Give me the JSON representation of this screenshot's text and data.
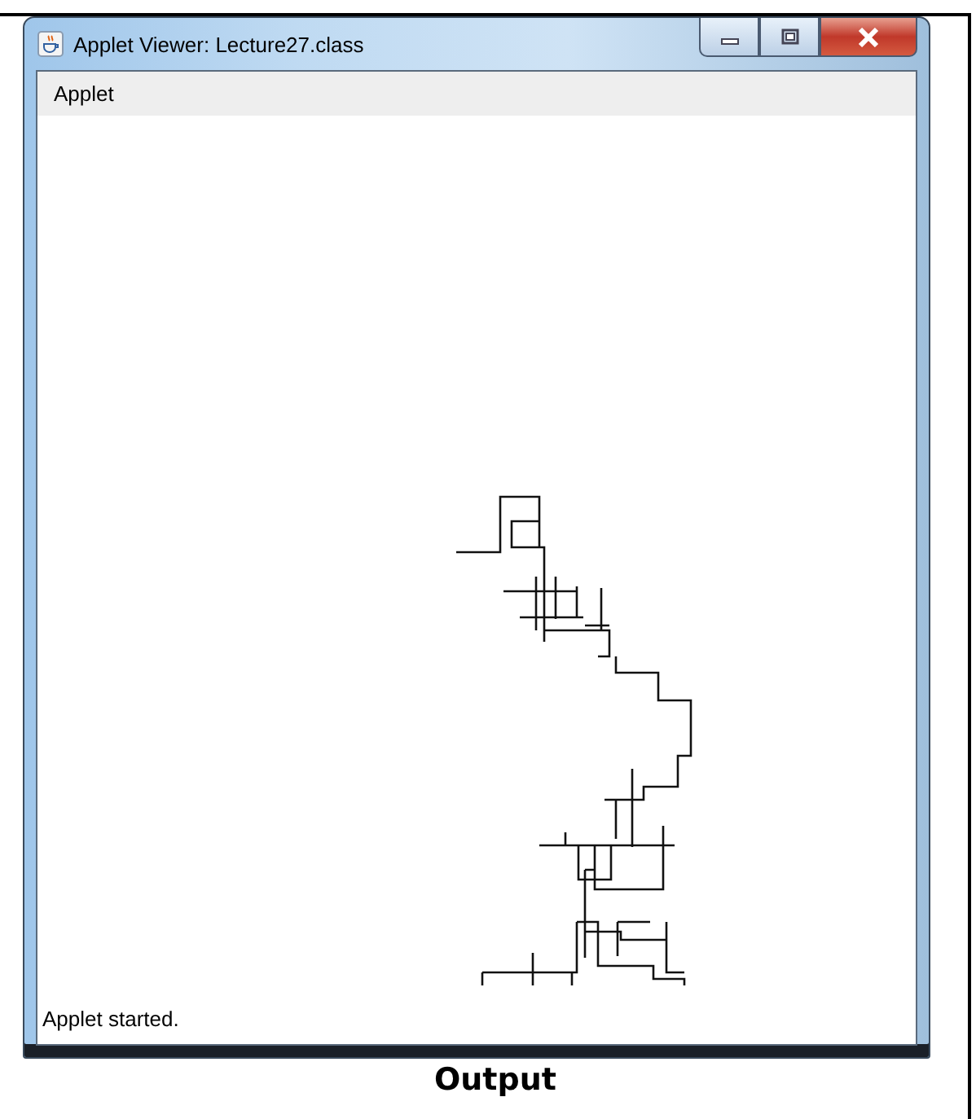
{
  "window": {
    "title": "Applet Viewer: Lecture27.class"
  },
  "menu_bar": {
    "items": [
      "Applet"
    ]
  },
  "status_bar": {
    "text": "Applet started."
  },
  "caption": "Output"
}
